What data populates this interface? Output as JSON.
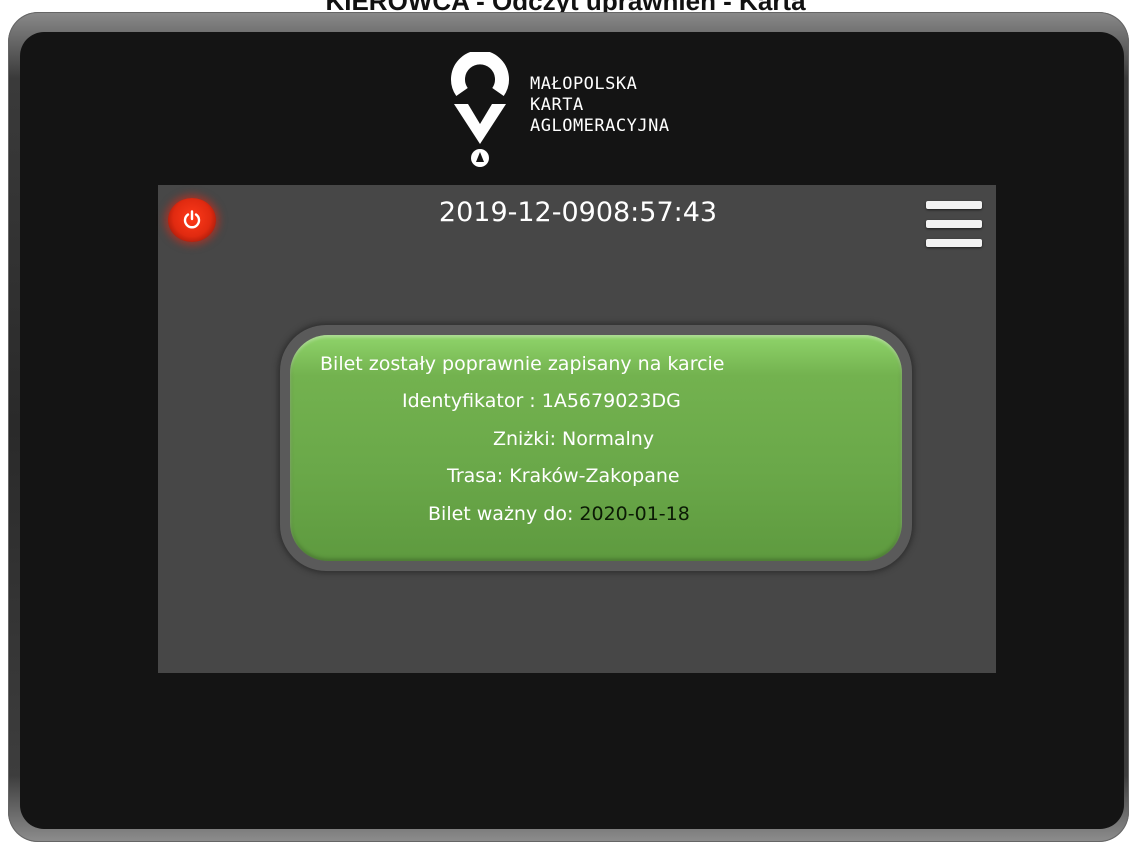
{
  "page": {
    "title": "KIEROWCA - Odczyt uprawnień - Karta"
  },
  "logo": {
    "line1": "MAŁOPOLSKA",
    "line2": "KARTA",
    "line3": "AGLOMERACYJNA"
  },
  "header": {
    "date": "2019-12-09",
    "time": "08:57:43"
  },
  "message": {
    "line1": "Bilet zostały poprawnie  zapisany na karcie",
    "id_label": "Identyfikator : ",
    "id_value": "1A5679023DG",
    "discount_label": "Zniżki: ",
    "discount_value": "Normalny",
    "route_label": "Trasa: ",
    "route_value": "Kraków-Zakopane",
    "valid_label": "Bilet ważny do: ",
    "valid_value": "2020-01-18"
  },
  "icons": {
    "power": "power-icon",
    "menu": "hamburger-menu-icon",
    "logo": "map-pin-logo-icon"
  },
  "colors": {
    "power_red": "#e02a10",
    "message_green": "#6aa849",
    "screen_gray": "#474747",
    "bezel_black": "#141414"
  }
}
